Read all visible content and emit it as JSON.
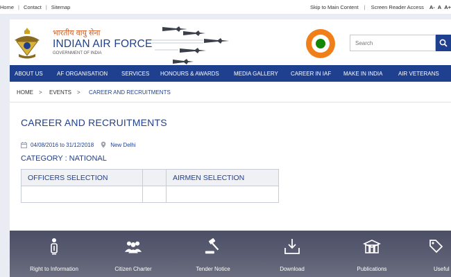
{
  "topbar": {
    "links": [
      "Home",
      "Contact",
      "Sitemap"
    ],
    "skip_link": "Skip to Main Content",
    "reader_link": "Screen Reader Access",
    "font_sizes": [
      "A-",
      "A",
      "A+"
    ]
  },
  "header": {
    "hindi_name": "भारतीय वायु सेना",
    "english_name": "INDIAN AIR FORCE",
    "govt_line": "GOVERNMENT OF INDIA",
    "search_placeholder": "Search",
    "colors": {
      "brand": "#1f3f8f",
      "saffron": "#f07f19",
      "green": "#138808"
    }
  },
  "nav": {
    "items": [
      "ABOUT US",
      "AF ORGANISATION",
      "SERVICES",
      "HONOURS & AWARDS",
      "MEDIA GALLERY",
      "CAREER IN IAF",
      "MAKE IN INDIA",
      "AIR VETERANS"
    ]
  },
  "breadcrumb": {
    "items": [
      "HOME",
      "EVENTS",
      "CAREER AND RECRUITMENTS"
    ],
    "separator": ">"
  },
  "main": {
    "title": "CAREER AND RECRUITMENTS",
    "date_range": "04/08/2016 to 31/12/2018",
    "location": "New Delhi",
    "category": "CATEGORY : NATIONAL",
    "table_headers": [
      "OFFICERS SELECTION",
      "",
      "AIRMEN SELECTION"
    ]
  },
  "footer": {
    "tiles": [
      {
        "label": "Right to Information",
        "icon": "info-person-icon"
      },
      {
        "label": "Citizen Charter",
        "icon": "group-icon"
      },
      {
        "label": "Tender Notice",
        "icon": "gavel-icon"
      },
      {
        "label": "Download",
        "icon": "download-tray-icon"
      },
      {
        "label": "Publications",
        "icon": "books-icon"
      },
      {
        "label": "Useful",
        "icon": "tag-icon"
      }
    ]
  }
}
